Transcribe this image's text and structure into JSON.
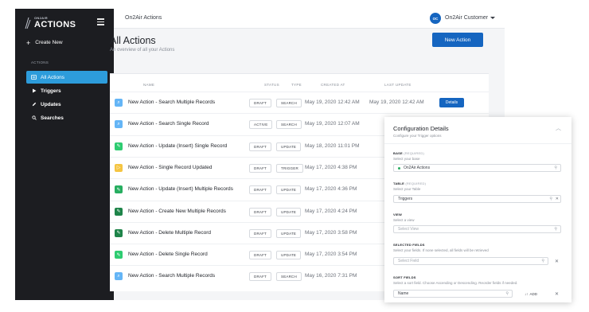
{
  "brand": {
    "small": "ON2AIR",
    "big": "ACTIONS"
  },
  "sidebar": {
    "create_label": "Create New",
    "section_label": "ACTIONS",
    "items": [
      {
        "label": "All Actions",
        "icon": "list-icon"
      },
      {
        "label": "Triggers",
        "icon": "play-icon"
      },
      {
        "label": "Updates",
        "icon": "edit-icon"
      },
      {
        "label": "Searches",
        "icon": "search-icon"
      }
    ]
  },
  "topbar": {
    "title": "On2Air Actions",
    "avatar_initials": "OC",
    "user_name": "On2Air Customer"
  },
  "page": {
    "title": "All Actions",
    "subtitle": "An overview of all your Actions",
    "new_action_label": "New Action"
  },
  "table": {
    "headers": [
      "NAME",
      "STATUS",
      "TYPE",
      "CREATED AT",
      "LAST UPDATE"
    ],
    "details_label": "Details",
    "rows": [
      {
        "name": "New Action - Search Multiple Records",
        "status": "DRAFT",
        "type": "SEARCH",
        "created": "May 19, 2020 12:42 AM",
        "updated": "May 19, 2020 12:42 AM",
        "icon": "search-icon",
        "color": "#64b5f6"
      },
      {
        "name": "New Action - Search Single Record",
        "status": "ACTIVE",
        "type": "SEARCH",
        "created": "May 19, 2020 12:07 AM",
        "updated": "",
        "icon": "search-icon",
        "color": "#64b5f6"
      },
      {
        "name": "New Action - Update (Insert) Single Record",
        "status": "DRAFT",
        "type": "UPDATE",
        "created": "May 18, 2020 11:01 PM",
        "updated": "",
        "icon": "edit-icon",
        "color": "#2ecc71"
      },
      {
        "name": "New Action - Single Record Updated",
        "status": "DRAFT",
        "type": "TRIGGER",
        "created": "May 17, 2020 4:38 PM",
        "updated": "",
        "icon": "play-icon",
        "color": "#f5c542"
      },
      {
        "name": "New Action - Update (Insert) Multiple Records",
        "status": "DRAFT",
        "type": "UPDATE",
        "created": "May 17, 2020 4:36 PM",
        "updated": "",
        "icon": "edit-icon",
        "color": "#27ae60"
      },
      {
        "name": "New Action - Create New Multiple Records",
        "status": "DRAFT",
        "type": "UPDATE",
        "created": "May 17, 2020 4:24 PM",
        "updated": "",
        "icon": "edit-icon",
        "color": "#1e8449"
      },
      {
        "name": "New Action - Delete Multiple Record",
        "status": "DRAFT",
        "type": "UPDATE",
        "created": "May 17, 2020 3:58 PM",
        "updated": "",
        "icon": "edit-icon",
        "color": "#1e8449"
      },
      {
        "name": "New Action - Delete Single Record",
        "status": "DRAFT",
        "type": "UPDATE",
        "created": "May 17, 2020 3:54 PM",
        "updated": "",
        "icon": "edit-icon",
        "color": "#2ecc71"
      },
      {
        "name": "New Action - Search Multiple Records",
        "status": "DRAFT",
        "type": "SEARCH",
        "created": "May 16, 2020 7:31 PM",
        "updated": "",
        "icon": "search-icon",
        "color": "#64b5f6"
      }
    ]
  },
  "config": {
    "title": "Configuration Details",
    "subtitle": "Configure your Trigger options",
    "base": {
      "label": "BASE",
      "req": "(REQUIRED)",
      "help": "Select your base",
      "value": "On2Air Actions"
    },
    "table": {
      "label": "TABLE",
      "req": "(REQUIRED)",
      "help": "Select your Table",
      "value": "Triggers"
    },
    "view": {
      "label": "VIEW",
      "help": "Select a view",
      "placeholder": "Select View"
    },
    "selected_fields": {
      "label": "SELECTED FIELDS",
      "help": "Select your fields. If none selected, all fields will be retrieved",
      "placeholder": "Select Field"
    },
    "sort_fields": {
      "label": "SORT FIELDS",
      "help": "Select a sort field. Choose Ascending or Descending. Reorder fields if needed.",
      "value": "Name",
      "add_label": "ADD"
    }
  }
}
